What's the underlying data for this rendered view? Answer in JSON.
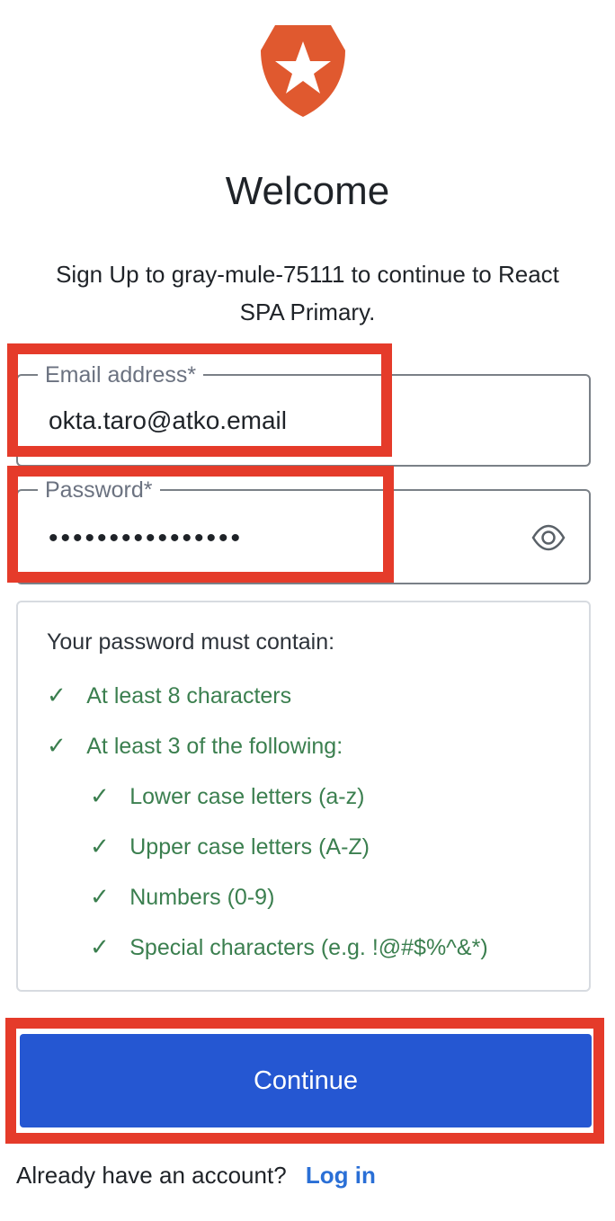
{
  "brand": {
    "logo_icon": "auth0-shield-star-icon",
    "accent": "#E0592F"
  },
  "header": {
    "title": "Welcome",
    "subtitle_line1": "Sign Up to gray-mule-75111 to continue to React",
    "subtitle_line2": "SPA Primary."
  },
  "form": {
    "email_label": "Email address*",
    "email_value": "okta.taro@atko.email",
    "password_label": "Password*",
    "password_value": "••••••••••••••••",
    "show_password_icon": "eye-icon"
  },
  "requirements": {
    "title": "Your password must contain:",
    "items": [
      "At least 8 characters",
      "At least 3 of the following:"
    ],
    "subitems": [
      "Lower case letters (a-z)",
      "Upper case letters (A-Z)",
      "Numbers (0-9)",
      "Special characters (e.g. !@#$%^&*)"
    ],
    "check_glyph": "✓",
    "status_color": "#3B7F4F"
  },
  "actions": {
    "continue_label": "Continue",
    "button_color": "#2557D2"
  },
  "footer": {
    "prompt": "Already have an account?",
    "login_label": "Log in"
  },
  "annotation_color": "#E53B2A"
}
